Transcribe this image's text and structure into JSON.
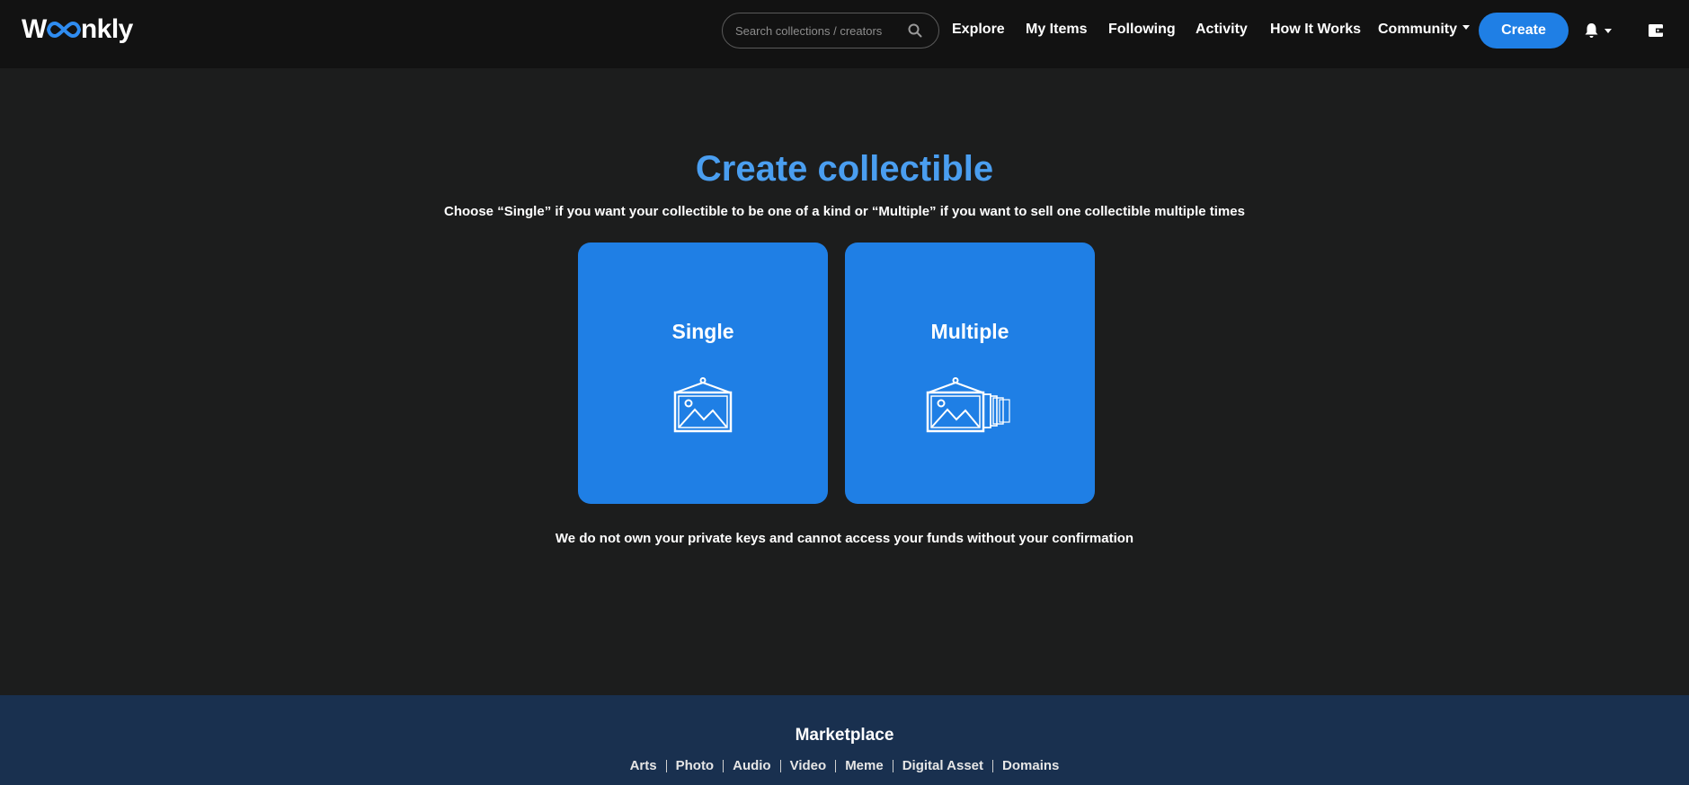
{
  "brand": {
    "name_pre": "W",
    "name_post": "nkly",
    "accent": "#2f8cf0"
  },
  "search": {
    "placeholder": "Search collections / creators"
  },
  "nav": {
    "explore": "Explore",
    "my_items": "My Items",
    "following": "Following",
    "activity": "Activity",
    "how_it_works": "How It Works",
    "community": "Community",
    "create": "Create"
  },
  "main": {
    "title": "Create collectible",
    "subtitle": "Choose “Single” if you want your collectible to be one of a kind or “Multiple” if you want to sell one collectible multiple times",
    "single_label": "Single",
    "multiple_label": "Multiple",
    "notice": "We do not own your private keys and cannot access your funds without your confirmation"
  },
  "footer": {
    "title": "Marketplace",
    "links": [
      "Arts",
      "Photo",
      "Audio",
      "Video",
      "Meme",
      "Digital Asset",
      "Domains"
    ]
  },
  "colors": {
    "background": "#1c1d1d",
    "navbar": "#121212",
    "primary": "#1f7fe5",
    "title": "#4a9ef0",
    "footer": "#19304f"
  },
  "icons": [
    "search-icon",
    "bell-icon",
    "wallet-icon",
    "framed-picture-icon",
    "stacked-pictures-icon"
  ]
}
